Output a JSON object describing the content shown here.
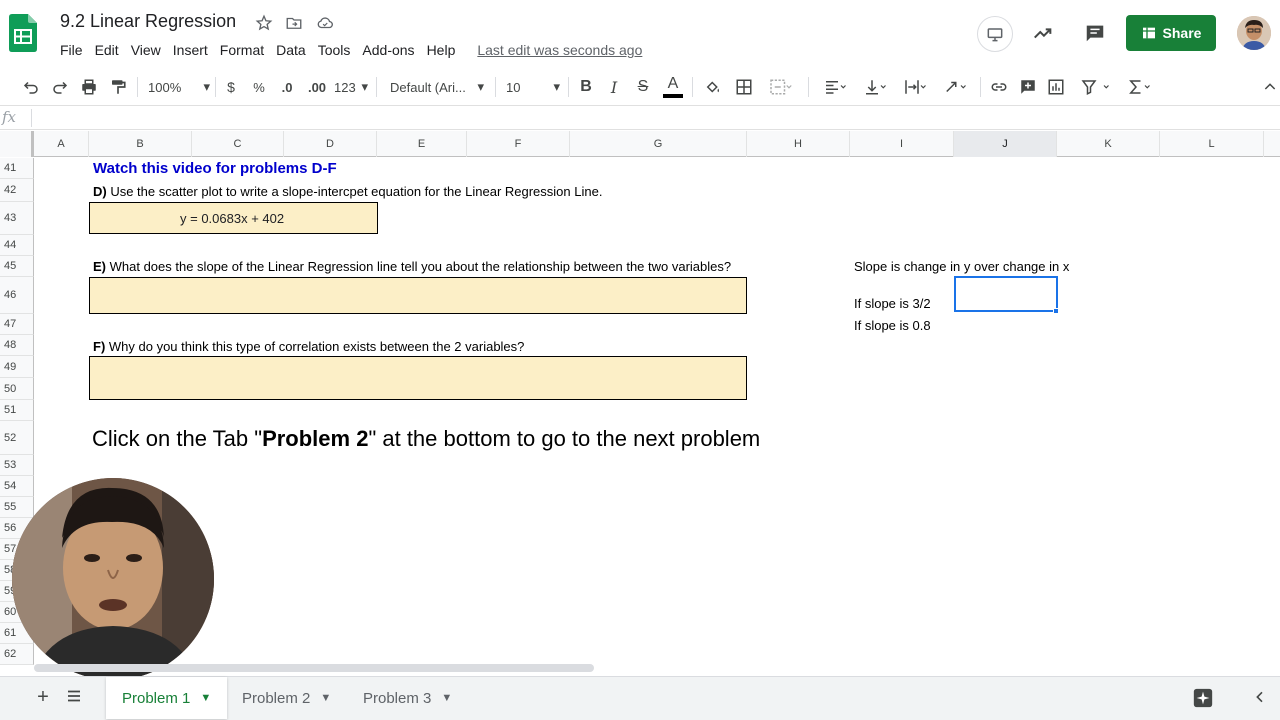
{
  "doc": {
    "title": "9.2 Linear Regression",
    "last_edit": "Last edit was seconds ago",
    "share_label": "Share"
  },
  "menu": [
    "File",
    "Edit",
    "View",
    "Insert",
    "Format",
    "Data",
    "Tools",
    "Add-ons",
    "Help"
  ],
  "toolbar": {
    "zoom": "100%",
    "currency": "$",
    "percent": "%",
    "dec_decrease": ".0",
    "dec_increase": ".00",
    "more_formats": "123",
    "font": "Default (Ari...",
    "font_size": "10",
    "bold": "B",
    "italic": "I",
    "strike": "S",
    "text_color": "A"
  },
  "formula_bar": {
    "fx": "fx",
    "value": ""
  },
  "columns": [
    "A",
    "B",
    "C",
    "D",
    "E",
    "F",
    "G",
    "H",
    "I",
    "J",
    "K",
    "L"
  ],
  "selected_column": "J",
  "rows": [
    "41",
    "42",
    "43",
    "44",
    "45",
    "46",
    "47",
    "48",
    "49",
    "50",
    "51",
    "52",
    "53",
    "54",
    "55",
    "56",
    "57",
    "58",
    "59",
    "60",
    "61",
    "62"
  ],
  "cells": {
    "heading": "Watch this video for problems D-F",
    "q_d_prefix": "D)",
    "q_d_text": " Use the scatter plot to write a slope-intercpet equation for the Linear Regression Line.",
    "answer_d": "y = 0.0683x + 402",
    "q_e_prefix": "E)",
    "q_e_text": " What does the slope of the Linear Regression line tell you about the relationship between the two variables?",
    "q_f_prefix": "F)",
    "q_f_text": " Why do you think this type of correlation exists between the 2 variables?",
    "note_1": "Slope is change in y over change in x",
    "note_2": "If slope is 3/2",
    "note_3": "If slope is 0.8",
    "instr_1": "Click on the Tab \"",
    "instr_bold": "Problem 2",
    "instr_2": "\" at the bottom to go to the next problem"
  },
  "sheets": [
    {
      "label": "Problem 1",
      "active": true
    },
    {
      "label": "Problem 2",
      "active": false
    },
    {
      "label": "Problem 3",
      "active": false
    }
  ],
  "colors": {
    "accent_green": "#188038",
    "answer_fill": "#fcefc7",
    "heading_blue": "#0000cc",
    "selection_blue": "#1a73e8"
  }
}
